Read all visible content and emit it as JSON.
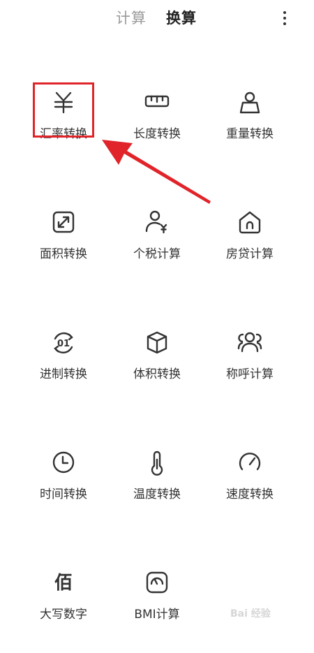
{
  "header": {
    "tab_calculate": "计算",
    "tab_convert": "换算",
    "active_tab": "换算"
  },
  "tools": [
    {
      "icon": "yuan-icon",
      "label": "汇率转换"
    },
    {
      "icon": "ruler-icon",
      "label": "长度转换"
    },
    {
      "icon": "weight-icon",
      "label": "重量转换"
    },
    {
      "icon": "area-icon",
      "label": "面积转换"
    },
    {
      "icon": "person-tax-icon",
      "label": "个税计算"
    },
    {
      "icon": "house-icon",
      "label": "房贷计算"
    },
    {
      "icon": "binary-icon",
      "label": "进制转换"
    },
    {
      "icon": "cube-icon",
      "label": "体积转换"
    },
    {
      "icon": "people-icon",
      "label": "称呼计算"
    },
    {
      "icon": "clock-icon",
      "label": "时间转换"
    },
    {
      "icon": "thermometer-icon",
      "label": "温度转换"
    },
    {
      "icon": "speedometer-icon",
      "label": "速度转换"
    },
    {
      "icon": "bai-character-icon",
      "label": "大写数字"
    },
    {
      "icon": "bmi-gauge-icon",
      "label": "BMI计算"
    }
  ],
  "icon_glyphs": {
    "binary_text": "01",
    "bai_char": "佰"
  },
  "annotation": {
    "highlight_color": "#e0242a"
  },
  "watermark": "Bai 经验"
}
